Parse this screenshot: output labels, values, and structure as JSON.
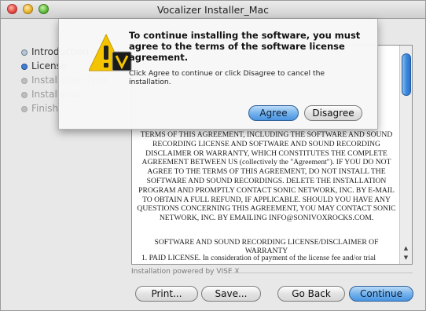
{
  "window": {
    "title": "Vocalizer Installer_Mac"
  },
  "steps": [
    {
      "label": "Introduction",
      "state": "done"
    },
    {
      "label": "License",
      "state": "current"
    },
    {
      "label": "Installation Type",
      "state": "future"
    },
    {
      "label": "Installation",
      "state": "future"
    },
    {
      "label": "Finish",
      "state": "future"
    }
  ],
  "license": {
    "paragraph": "TERMS OF THIS AGREEMENT, INCLUDING THE SOFTWARE AND SOUND RECORDING LICENSE AND SOFTWARE AND SOUND RECORDING DISCLAIMER OR WARRANTY, WHICH CONSTITUTES THE COMPLETE AGREEMENT BETWEEN US (collectively the \"Agreement\"). IF YOU DO NOT AGREE TO THE TERMS OF THIS AGREEMENT, DO NOT INSTALL THE SOFTWARE AND SOUND RECORDINGS. DELETE THE INSTALLATION PROGRAM AND PROMPTLY CONTACT SONIC NETWORK, INC. BY E-MAIL TO OBTAIN A FULL REFUND, IF APPLICABLE. SHOULD YOU HAVE ANY QUESTIONS CONCERNING THIS AGREEMENT, YOU MAY CONTACT SONIC NETWORK, INC. BY EMAILING INFO@SONIVOXROCKS.COM.",
    "heading": "SOFTWARE AND SOUND RECORDING LICENSE/DISCLAIMER OF WARRANTY",
    "clause": "1. PAID LICENSE. In consideration of payment of the license fee and/or trial"
  },
  "footer": {
    "powered_by": "Installation powered by VISE X",
    "print_label": "Print...",
    "save_label": "Save...",
    "goback_label": "Go Back",
    "continue_label": "Continue"
  },
  "sheet": {
    "title": "To continue installing the software, you must agree to the terms of the software license agreement.",
    "body": "Click Agree to continue or click Disagree to cancel the installation.",
    "agree_label": "Agree",
    "disagree_label": "Disagree"
  },
  "colors": {
    "accent": "#3f7fd6",
    "warning": "#f5c400"
  }
}
